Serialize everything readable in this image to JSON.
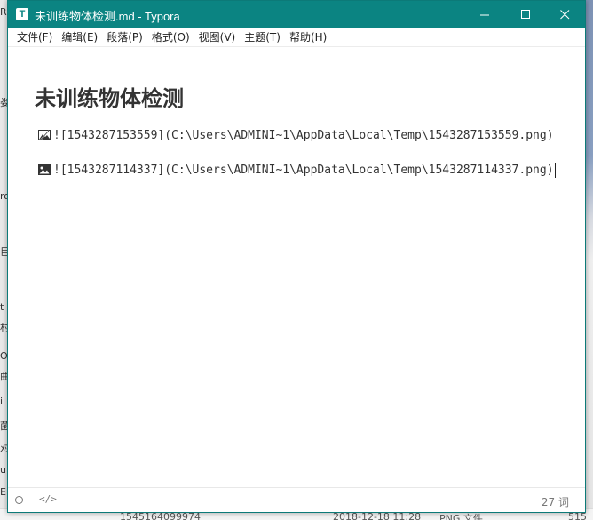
{
  "window": {
    "title": "未训练物体检测.md - Typora",
    "app_icon_letter": "T",
    "accent_color": "#0b8482"
  },
  "menu": {
    "items": [
      {
        "label": "文件(F)"
      },
      {
        "label": "编辑(E)"
      },
      {
        "label": "段落(P)"
      },
      {
        "label": "格式(O)"
      },
      {
        "label": "视图(V)"
      },
      {
        "label": "主题(T)"
      },
      {
        "label": "帮助(H)"
      }
    ]
  },
  "document": {
    "heading": "未训练物体检测",
    "lines": [
      {
        "icon": "broken-image-icon",
        "text": "![1543287153559](C:\\Users\\ADMINI~1\\AppData\\Local\\Temp\\1543287153559.png)"
      },
      {
        "icon": "image-icon",
        "text": "![1543287114337](C:\\Users\\ADMINI~1\\AppData\\Local\\Temp\\1543287114337.png)"
      }
    ]
  },
  "status": {
    "source_toggle": "</>",
    "word_count": "27 词"
  },
  "background": {
    "left_fragments": [
      "R",
      "娄",
      "ro",
      "巨",
      "t",
      "村",
      "Or",
      "曲",
      "i",
      "菌",
      "对",
      "u",
      "E"
    ],
    "bottom_fragments": [
      "1545164099974",
      "2018-12-18 11:28",
      "PNG 文件",
      "515"
    ]
  }
}
